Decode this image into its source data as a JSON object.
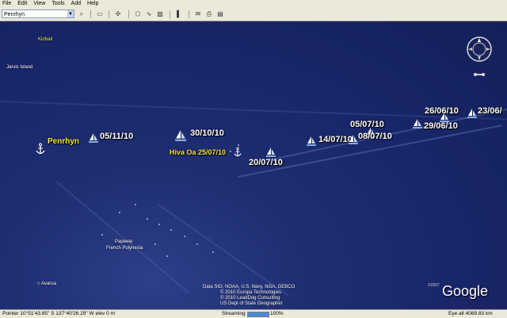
{
  "menu": {
    "file": "File",
    "edit": "Edit",
    "view": "View",
    "tools": "Tools",
    "add": "Add",
    "help": "Help"
  },
  "search": {
    "value": "Penrhyn"
  },
  "map": {
    "places": {
      "kiribati": "Kiribati",
      "jarvis": "Jarvis Island",
      "papeete": "Papeete",
      "french_polynesia": "French Polynesia",
      "avarua": "Avarua"
    },
    "markers": {
      "penrhyn": "Penrhyn",
      "hiva_oa": "Hiva Oa 25/07/10",
      "d_05_11": "05/11/10",
      "d_30_10": "30/10/10",
      "d_20_07": "20/07/10",
      "d_14_07": "14/07/10",
      "d_05_07": "05/07/10",
      "d_08_07": "08/07/10",
      "d_29_06": "29/06/10",
      "d_26_06": "26/06/10",
      "d_23_06": "23/06/"
    },
    "credits": [
      "Data SIO, NOAA, U.S. Navy, NGA, GEBCO",
      "© 2010 Europa Technologies",
      "© 2010 LeadDog Consulting",
      "US Dept of State Geographer"
    ],
    "copyright_year": "©2007",
    "logo": "Google"
  },
  "status": {
    "pointer": "Pointer  10°51'43.85\" S    137°40'26.29\" W  elev   0 m",
    "streaming": "Streaming",
    "streaming_percent": "100%",
    "streaming_fraction": 1.0,
    "eye_alt": "Eye alt   4089.83 km"
  },
  "colors": {
    "label": "#ffffff",
    "anchor_label": "#f5e642",
    "ocean": "#1f2e72"
  }
}
